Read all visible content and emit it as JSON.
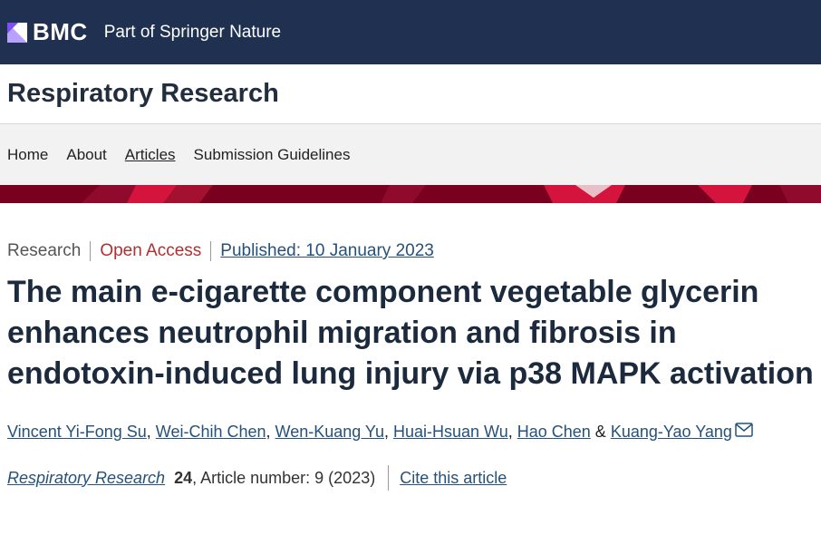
{
  "header": {
    "logo_text": "BMC",
    "tagline": "Part of Springer Nature"
  },
  "journal": {
    "title": "Respiratory Research"
  },
  "nav": {
    "items": [
      {
        "label": "Home"
      },
      {
        "label": "About"
      },
      {
        "label": "Articles"
      },
      {
        "label": "Submission Guidelines"
      }
    ]
  },
  "article": {
    "type": "Research",
    "access": "Open Access",
    "published": "Published: 10 January 2023",
    "title": "The main e-cigarette component vegetable glycerin enhances neutrophil migration and fibrosis in endotoxin-induced lung injury via p38 MAPK activation",
    "authors": [
      "Vincent Yi-Fong Su",
      "Wei-Chih Chen",
      "Wen-Kuang Yu",
      "Huai-Hsuan Wu",
      "Hao Chen",
      "Kuang-Yao Yang"
    ],
    "author_sep": ", ",
    "author_and": " & ",
    "citation": {
      "journal": "Respiratory Research",
      "volume": "24",
      "rest": ", Article number: 9 (2023)",
      "cite_link": "Cite this article"
    }
  },
  "colors": {
    "header_bg": "#1f3050",
    "banner": "#7a0020",
    "link": "#25517a",
    "open_access": "#b03030"
  }
}
